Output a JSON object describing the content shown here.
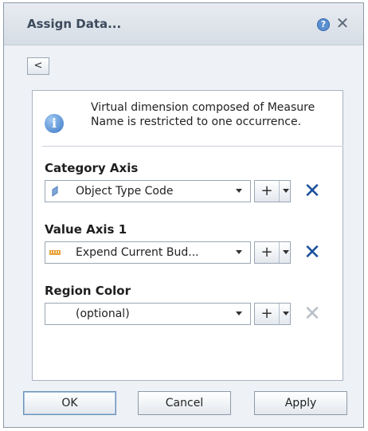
{
  "dialog": {
    "title": "Assign Data...",
    "help_icon": "?",
    "close_icon": "✕"
  },
  "back_label": "<",
  "info": {
    "icon": "i",
    "text": "Virtual dimension composed of Measure Name is restricted to one occurrence."
  },
  "fields": [
    {
      "label": "Category Axis",
      "value": "Object Type Code",
      "icon": "dimension-icon",
      "plus": "+",
      "remove_enabled": true
    },
    {
      "label": "Value Axis 1",
      "value": "Expend Current Bud...",
      "icon": "measure-icon",
      "plus": "+",
      "remove_enabled": true
    },
    {
      "label": "Region Color",
      "value": "(optional)",
      "icon": "",
      "plus": "+",
      "remove_enabled": false
    }
  ],
  "buttons": {
    "ok": "OK",
    "cancel": "Cancel",
    "apply": "Apply"
  },
  "colors": {
    "remove_active": "#1b4f9c",
    "remove_disabled": "#b9c0c8",
    "title_text": "#3c4a5c"
  }
}
